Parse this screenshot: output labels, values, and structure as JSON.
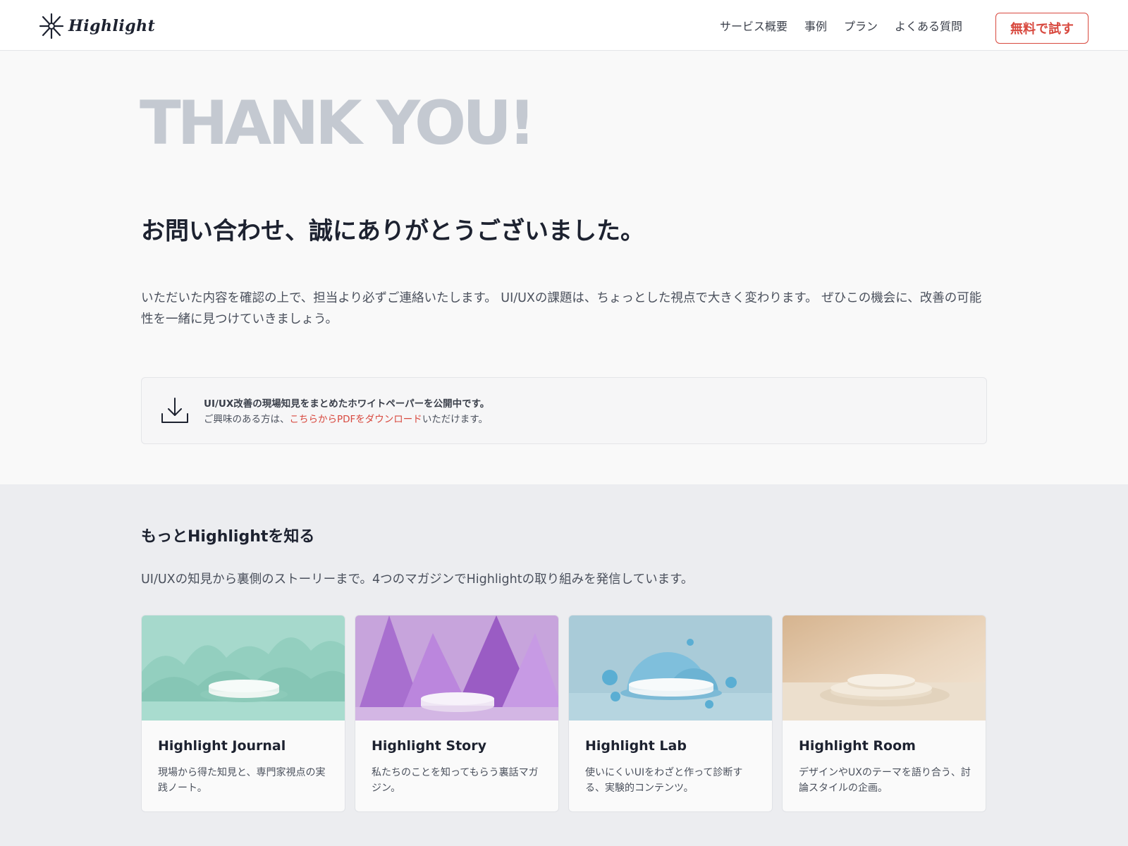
{
  "header": {
    "logo_text": "Highlight",
    "nav": [
      {
        "label": "サービス概要"
      },
      {
        "label": "事例"
      },
      {
        "label": "プラン"
      },
      {
        "label": "よくある質問"
      }
    ],
    "cta_label": "無料で試す"
  },
  "thanks": {
    "hero": "THANK YOU!",
    "heading": "お問い合わせ、誠にありがとうございました。",
    "body": "いただいた内容を確認の上で、担当より必ずご連絡いたします。 UI/UXの課題は、ちょっとした視点で大きく変わります。 ぜひこの機会に、改善の可能性を一緒に見つけていきましょう。",
    "notice": {
      "title": "UI/UX改善の現場知見をまとめたホワイトペーパーを公開中です。",
      "text_before": "ご興味のある方は、",
      "link": "こちらからPDFをダウンロード",
      "text_after": "いただけます。",
      "icon": "download-icon"
    }
  },
  "more": {
    "heading": "もっとHighlightを知る",
    "lead": "UI/UXの知見から裏側のストーリーまで。4つのマガジンでHighlightの取り組みを発信しています。",
    "cards": [
      {
        "title": "Highlight Journal",
        "desc": "現場から得た知見と、専門家視点の実践ノート。"
      },
      {
        "title": "Highlight Story",
        "desc": "私たちのことを知ってもらう裏話マガジン。"
      },
      {
        "title": "Highlight Lab",
        "desc": "使いにくいUIをわざと作って診断する、実験的コンテンツ。"
      },
      {
        "title": "Highlight Room",
        "desc": "デザインやUXのテーマを語り合う、討論スタイルの企画。"
      }
    ]
  },
  "colors": {
    "accent": "#d8493f",
    "hero_text": "#c4c9d1",
    "text": "#1d2230",
    "section_bg": "#ecedf0"
  }
}
